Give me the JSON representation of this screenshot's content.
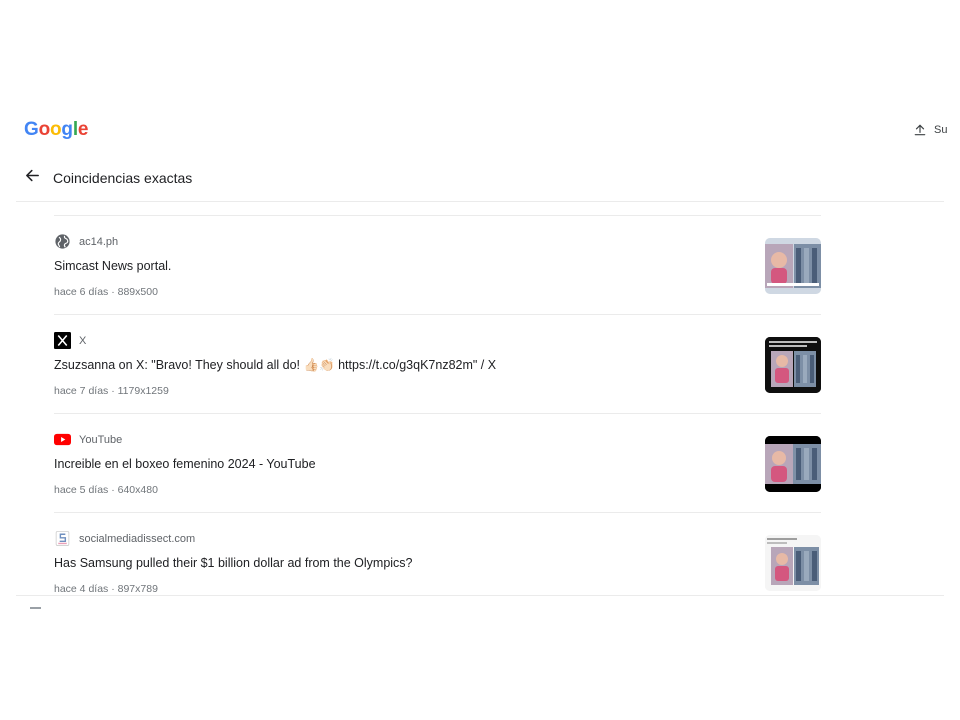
{
  "brand": {
    "letters": [
      {
        "char": "G",
        "color": "#4285F4"
      },
      {
        "char": "o",
        "color": "#EA4335"
      },
      {
        "char": "o",
        "color": "#FBBC05"
      },
      {
        "char": "g",
        "color": "#4285F4"
      },
      {
        "char": "l",
        "color": "#34A853"
      },
      {
        "char": "e",
        "color": "#EA4335"
      }
    ]
  },
  "toolbar": {
    "upload_icon": "upload-icon",
    "upload_label": "Su"
  },
  "header": {
    "back_icon": "arrow-back-icon",
    "title": "Coincidencias exactas"
  },
  "results": [
    {
      "source": "ac14.ph",
      "icon": "globe-icon",
      "title": "Simcast News portal.",
      "meta": "hace 6 días · 889x500",
      "thumb_style": "light"
    },
    {
      "source": "X",
      "icon": "x-logo-icon",
      "title": "Zsuzsanna on X: \"Bravo! They should all do! 👍🏻👏🏻 https://t.co/g3qK7nz82m\" / X",
      "meta": "hace 7 días · 1179x1259",
      "thumb_style": "dark"
    },
    {
      "source": "YouTube",
      "icon": "youtube-icon",
      "title": "Increible en el boxeo femenino 2024 - YouTube",
      "meta": "hace 5 días · 640x480",
      "thumb_style": "dark"
    },
    {
      "source": "socialmediadissect.com",
      "icon": "socialmediadissect-icon",
      "title": "Has Samsung pulled their $1 billion dollar ad from the Olympics?",
      "meta": "hace 4 días · 897x789",
      "thumb_style": "light"
    }
  ],
  "colors": {
    "youtube_red": "#FF0000",
    "x_black": "#000000",
    "divider": "#EBEBEB",
    "meta_gray": "#70757A"
  }
}
